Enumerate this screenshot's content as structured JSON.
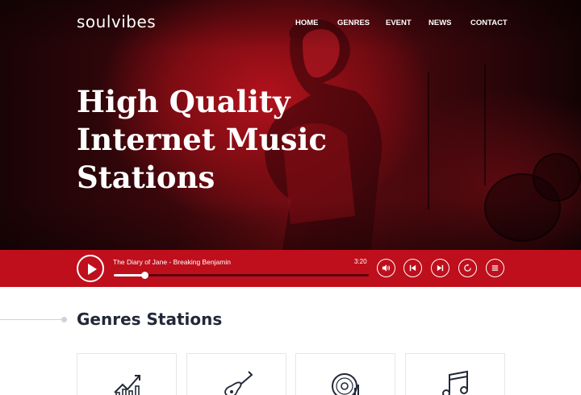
{
  "brand": {
    "logo": "soulvibes"
  },
  "nav": {
    "items": [
      "HOME",
      "GENRES",
      "EVENT",
      "NEWS",
      "CONTACT"
    ]
  },
  "hero": {
    "title_lines": [
      "High Quality",
      "Internet Music",
      "Stations"
    ]
  },
  "player": {
    "track": "The Diary of Jane - Breaking Benjamin",
    "time": "3:20",
    "progress": 0.12,
    "controls": [
      "volume",
      "previous",
      "next",
      "repeat",
      "playlist"
    ]
  },
  "genres": {
    "title": "Genres Stations",
    "cards": [
      {
        "icon": "chart-growth-icon"
      },
      {
        "icon": "electric-guitar-icon"
      },
      {
        "icon": "vinyl-record-icon"
      },
      {
        "icon": "music-notes-icon"
      }
    ]
  },
  "colors": {
    "accent": "#bf0f1c",
    "heading": "#222838"
  }
}
